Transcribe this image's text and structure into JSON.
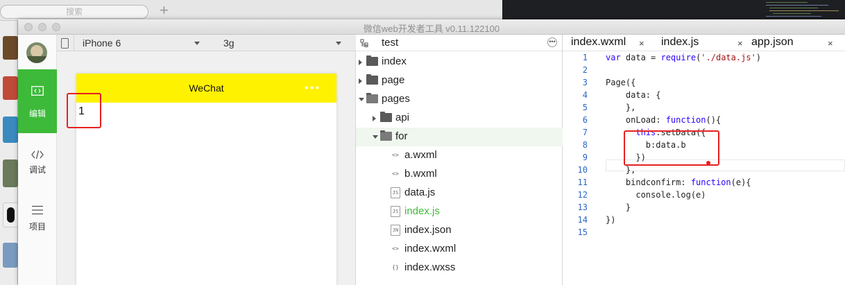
{
  "desktop": {
    "search_placeholder": "搜索",
    "plus_label": "+"
  },
  "window": {
    "title": "微信web开发者工具 v0.11.122100"
  },
  "leftnav": {
    "items": [
      {
        "label": "编辑",
        "icon": "code-icon",
        "active": true
      },
      {
        "label": "调试",
        "icon": "debug-icon",
        "active": false
      },
      {
        "label": "项目",
        "icon": "menu-icon",
        "active": false
      }
    ]
  },
  "simulator": {
    "device": "iPhone 6",
    "network": "3g",
    "nav_title": "WeChat",
    "nav_more": "•••",
    "content_text": "1"
  },
  "tree": {
    "title": "test",
    "more_icon": "•••",
    "items": [
      {
        "label": "index",
        "type": "folder",
        "level": 0,
        "expanded": false
      },
      {
        "label": "page",
        "type": "folder",
        "level": 0,
        "expanded": false
      },
      {
        "label": "pages",
        "type": "folder",
        "level": 0,
        "expanded": true
      },
      {
        "label": "api",
        "type": "folder",
        "level": 1,
        "expanded": false
      },
      {
        "label": "for",
        "type": "folder",
        "level": 1,
        "expanded": true,
        "selected": true
      },
      {
        "label": "a.wxml",
        "type": "wxml",
        "level": 2
      },
      {
        "label": "b.wxml",
        "type": "wxml",
        "level": 2
      },
      {
        "label": "data.js",
        "type": "js",
        "level": 2
      },
      {
        "label": "index.js",
        "type": "js",
        "level": 2,
        "active": true
      },
      {
        "label": "index.json",
        "type": "json",
        "level": 2
      },
      {
        "label": "index.wxml",
        "type": "wxml",
        "level": 2
      },
      {
        "label": "index.wxss",
        "type": "wxss",
        "level": 2
      }
    ]
  },
  "editor": {
    "tabs": [
      {
        "label": "index.wxml",
        "close": "×"
      },
      {
        "label": "index.js",
        "close": "×"
      },
      {
        "label": "app.json",
        "close": "×"
      }
    ],
    "line_numbers": [
      "1",
      "2",
      "3",
      "4",
      "5",
      "6",
      "7",
      "8",
      "9",
      "10",
      "11",
      "12",
      "13",
      "14",
      "15"
    ],
    "lines": [
      "var data = require('./data.js')",
      "",
      "Page({",
      "    data: {",
      "    },",
      "    onLoad: function(){",
      "      this.setData({",
      "        b:data.b",
      "      })",
      "    },",
      "    bindconfirm: function(e){",
      "      console.log(e)",
      "    }",
      "})",
      ""
    ]
  },
  "colors": {
    "accent_green": "#3dba3a",
    "wechat_yellow": "#fff200",
    "highlight_red": "#e62020",
    "line_number_blue": "#2a66c8"
  }
}
